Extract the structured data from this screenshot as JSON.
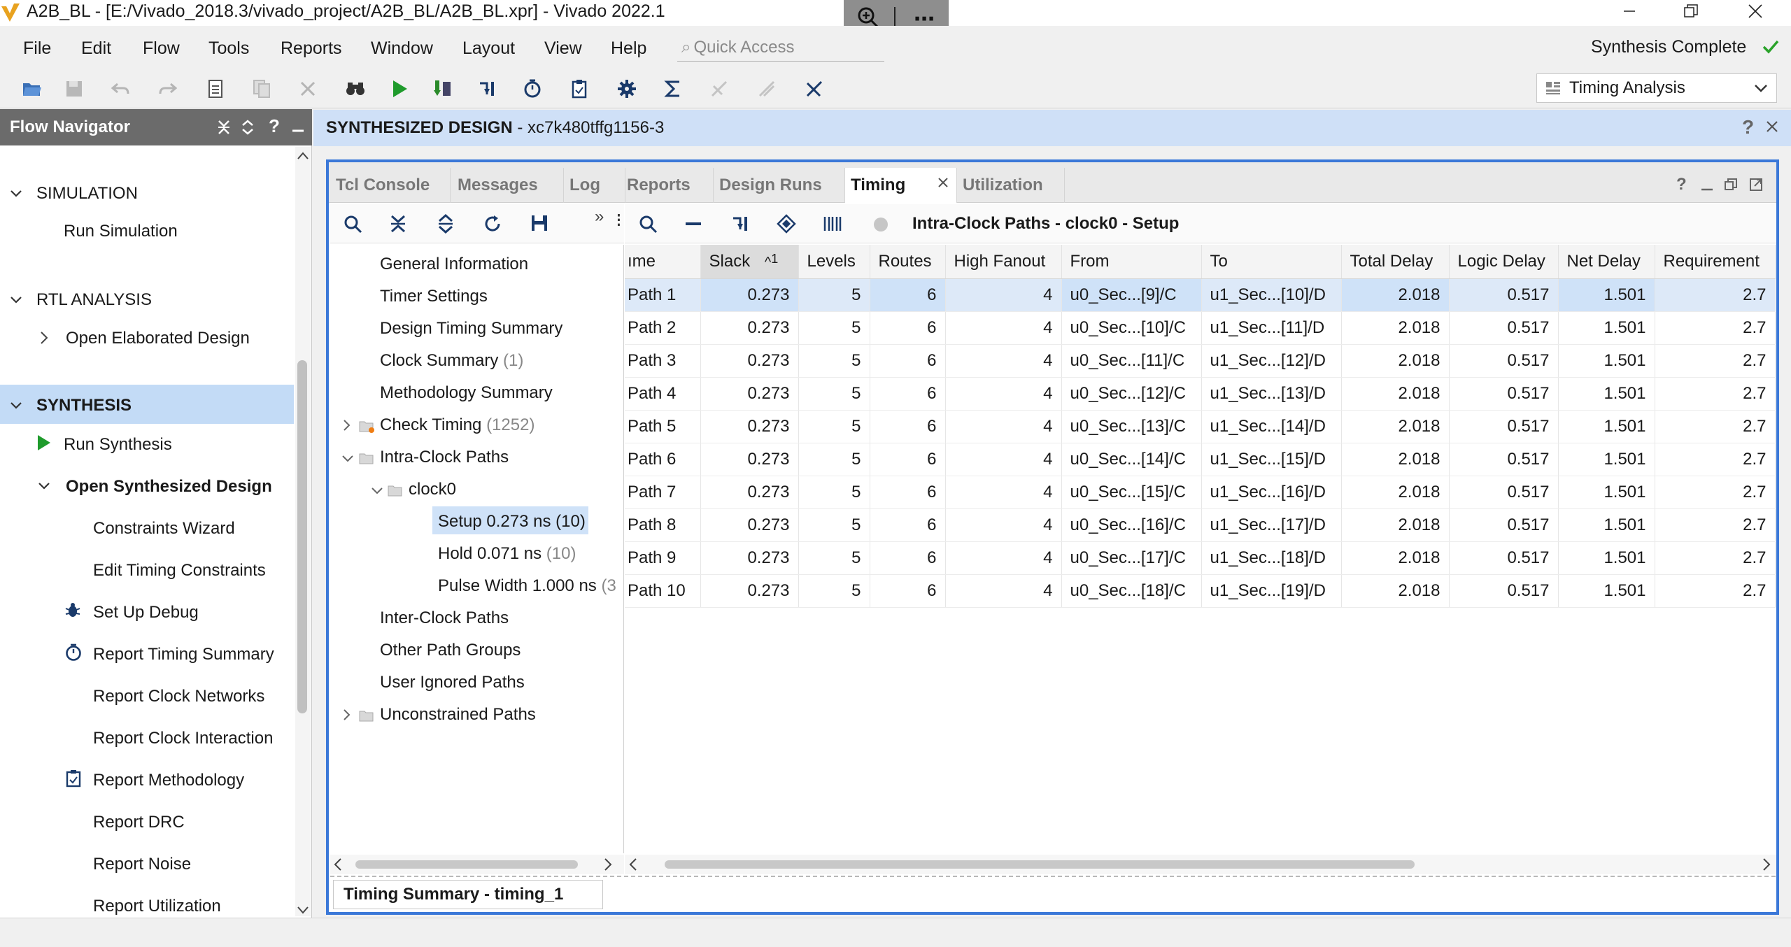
{
  "window": {
    "title": "A2B_BL - [E:/Vivado_2018.3/vivado_project/A2B_BL/A2B_BL.xpr] - Vivado 2022.1"
  },
  "menu": {
    "items": [
      "File",
      "Edit",
      "Flow",
      "Tools",
      "Reports",
      "Window",
      "Layout",
      "View",
      "Help"
    ],
    "quick_access_placeholder": "Quick Access",
    "status": "Synthesis Complete"
  },
  "toolbar": {
    "layout_selected": "Timing Analysis"
  },
  "flow_navigator": {
    "title": "Flow Navigator",
    "simulation": {
      "label": "SIMULATION",
      "run_simulation": "Run Simulation"
    },
    "rtl_analysis": {
      "label": "RTL ANALYSIS",
      "open_elaborated": "Open Elaborated Design"
    },
    "synthesis": {
      "label": "SYNTHESIS",
      "run_synthesis": "Run Synthesis",
      "open_synthesized": "Open Synthesized Design",
      "items": [
        "Constraints Wizard",
        "Edit Timing Constraints",
        "Set Up Debug",
        "Report Timing Summary",
        "Report Clock Networks",
        "Report Clock Interaction",
        "Report Methodology",
        "Report DRC",
        "Report Noise",
        "Report Utilization"
      ]
    }
  },
  "main": {
    "header_bold": "SYNTHESIZED DESIGN",
    "header_part": "- xc7k480tffg1156-3",
    "tabs": [
      "Tcl Console",
      "Messages",
      "Log",
      "Reports",
      "Design Runs",
      "Timing",
      "Utilization"
    ],
    "active_tab": "Timing",
    "table_title": "Intra-Clock Paths - clock0 - Setup",
    "bottom_tab": "Timing Summary - timing_1"
  },
  "tree": {
    "general_information": "General Information",
    "timer_settings": "Timer Settings",
    "design_timing_summary": "Design Timing Summary",
    "clock_summary": "Clock Summary",
    "clock_summary_count": "(1)",
    "methodology_summary": "Methodology Summary",
    "check_timing": "Check Timing",
    "check_timing_count": "(1252)",
    "intra_clock_paths": "Intra-Clock Paths",
    "clock0": "clock0",
    "setup": "Setup 0.273 ns (10)",
    "hold": "Hold 0.071 ns",
    "hold_count": "(10)",
    "pulse_width": "Pulse Width 1.000 ns",
    "pulse_width_count": "(3",
    "inter_clock_paths": "Inter-Clock Paths",
    "other_path_groups": "Other Path Groups",
    "user_ignored_paths": "User Ignored Paths",
    "unconstrained_paths": "Unconstrained Paths"
  },
  "table": {
    "columns": [
      "ıme",
      "Slack",
      "Levels",
      "Routes",
      "High Fanout",
      "From",
      "To",
      "Total Delay",
      "Logic Delay",
      "Net Delay",
      "Requirement"
    ],
    "sort_indicator": "1",
    "rows": [
      [
        "Path 1",
        "0.273",
        "5",
        "6",
        "4",
        "u0_Sec...[9]/C",
        "u1_Sec...[10]/D",
        "2.018",
        "0.517",
        "1.501",
        "2.7"
      ],
      [
        "Path 2",
        "0.273",
        "5",
        "6",
        "4",
        "u0_Sec...[10]/C",
        "u1_Sec...[11]/D",
        "2.018",
        "0.517",
        "1.501",
        "2.7"
      ],
      [
        "Path 3",
        "0.273",
        "5",
        "6",
        "4",
        "u0_Sec...[11]/C",
        "u1_Sec...[12]/D",
        "2.018",
        "0.517",
        "1.501",
        "2.7"
      ],
      [
        "Path 4",
        "0.273",
        "5",
        "6",
        "4",
        "u0_Sec...[12]/C",
        "u1_Sec...[13]/D",
        "2.018",
        "0.517",
        "1.501",
        "2.7"
      ],
      [
        "Path 5",
        "0.273",
        "5",
        "6",
        "4",
        "u0_Sec...[13]/C",
        "u1_Sec...[14]/D",
        "2.018",
        "0.517",
        "1.501",
        "2.7"
      ],
      [
        "Path 6",
        "0.273",
        "5",
        "6",
        "4",
        "u0_Sec...[14]/C",
        "u1_Sec...[15]/D",
        "2.018",
        "0.517",
        "1.501",
        "2.7"
      ],
      [
        "Path 7",
        "0.273",
        "5",
        "6",
        "4",
        "u0_Sec...[15]/C",
        "u1_Sec...[16]/D",
        "2.018",
        "0.517",
        "1.501",
        "2.7"
      ],
      [
        "Path 8",
        "0.273",
        "5",
        "6",
        "4",
        "u0_Sec...[16]/C",
        "u1_Sec...[17]/D",
        "2.018",
        "0.517",
        "1.501",
        "2.7"
      ],
      [
        "Path 9",
        "0.273",
        "5",
        "6",
        "4",
        "u0_Sec...[17]/C",
        "u1_Sec...[18]/D",
        "2.018",
        "0.517",
        "1.501",
        "2.7"
      ],
      [
        "Path 10",
        "0.273",
        "5",
        "6",
        "4",
        "u0_Sec...[18]/C",
        "u1_Sec...[19]/D",
        "2.018",
        "0.517",
        "1.501",
        "2.7"
      ]
    ]
  },
  "colors": {
    "accent_blue": "#3b78d8",
    "selection": "#c3dbf6",
    "run_green": "#1f9b2c"
  }
}
